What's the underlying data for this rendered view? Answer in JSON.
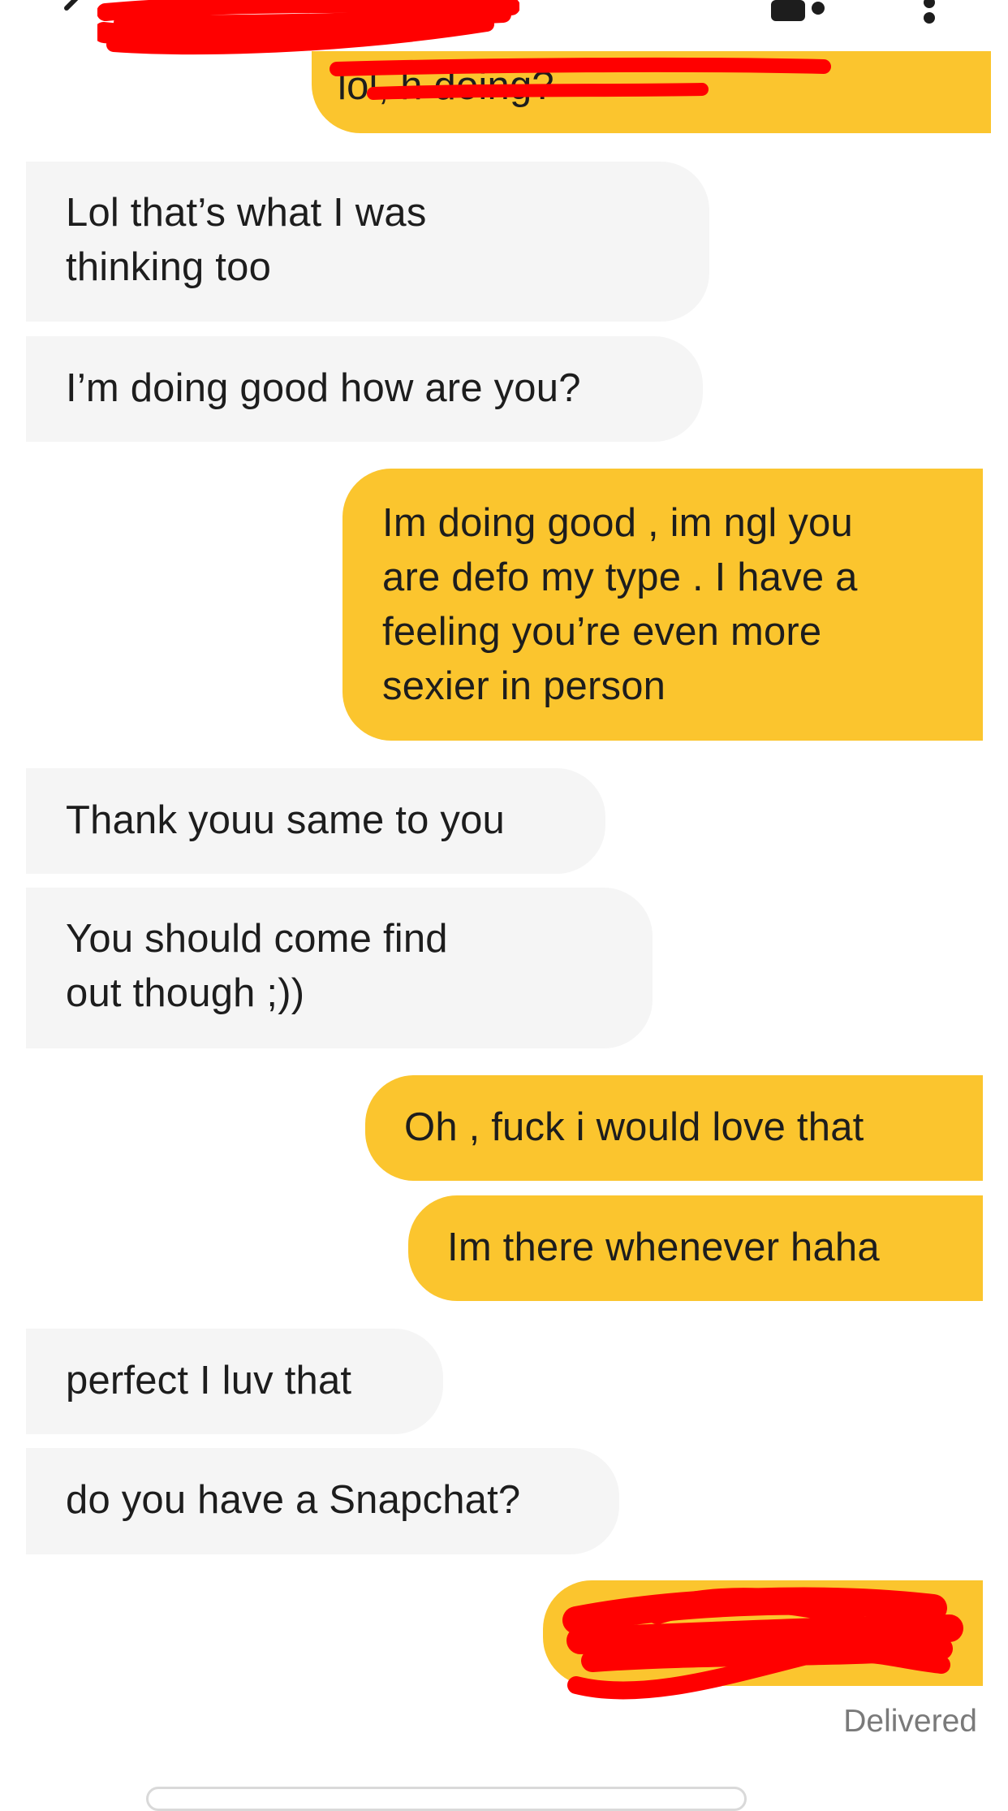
{
  "conversation": {
    "messages": [
      {
        "id": "m0",
        "sender": "me",
        "text": "lol, h              doing?",
        "redacted": true
      },
      {
        "id": "m1",
        "sender": "them",
        "text": "Lol that’s what I was\nthinking too"
      },
      {
        "id": "m2",
        "sender": "them",
        "text": "I’m doing good how are you?"
      },
      {
        "id": "m3",
        "sender": "me",
        "text": "Im doing good , im ngl you\nare defo my type . I have a\nfeeling you’re even more\nsexier in person"
      },
      {
        "id": "m4",
        "sender": "them",
        "text": "Thank youu same to you"
      },
      {
        "id": "m5",
        "sender": "them",
        "text": "You should come find\nout  though ;))"
      },
      {
        "id": "m6",
        "sender": "me",
        "text": "Oh , fuck i would love that"
      },
      {
        "id": "m7",
        "sender": "me",
        "text": "Im there whenever haha"
      },
      {
        "id": "m8",
        "sender": "them",
        "text": "perfect I luv that"
      },
      {
        "id": "m9",
        "sender": "them",
        "text": "do you have a Snapchat?"
      },
      {
        "id": "m10",
        "sender": "me",
        "text": "",
        "redacted": true
      }
    ],
    "status": "Delivered"
  },
  "header": {
    "icons": [
      "back-icon",
      "video-call-icon",
      "more-options-icon"
    ],
    "contact_name_redacted": true
  },
  "colors": {
    "outgoing_bubble": "#fbc52e",
    "incoming_bubble": "#f5f5f5",
    "redaction": "#ff0000",
    "status_text": "#7a7a7a"
  }
}
